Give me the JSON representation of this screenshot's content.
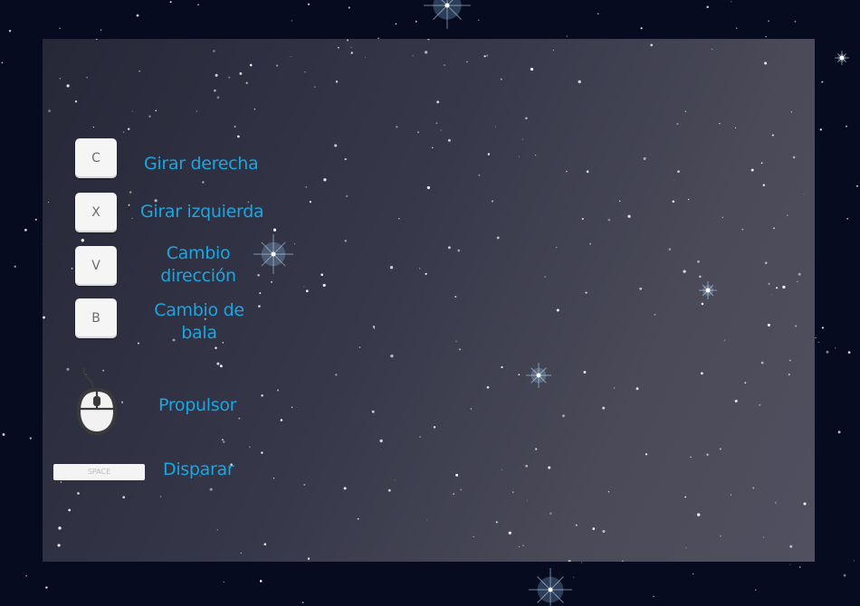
{
  "controls": [
    {
      "key": "C",
      "label": "Girar derecha"
    },
    {
      "key": "X",
      "label": "Girar izquierda"
    },
    {
      "key": "V",
      "label_line1": "Cambio",
      "label_line2": "dirección"
    },
    {
      "key": "B",
      "label_line1": "Cambio de",
      "label_line2": "bala"
    }
  ],
  "mouse_action": {
    "icon": "mouse-icon",
    "label": "Propulsor"
  },
  "space_action": {
    "key": "SPACE",
    "label": "Disparar"
  },
  "colors": {
    "label": "#1aa6e0",
    "key_bg": "#f5f5f5",
    "background": "#070b1f"
  }
}
